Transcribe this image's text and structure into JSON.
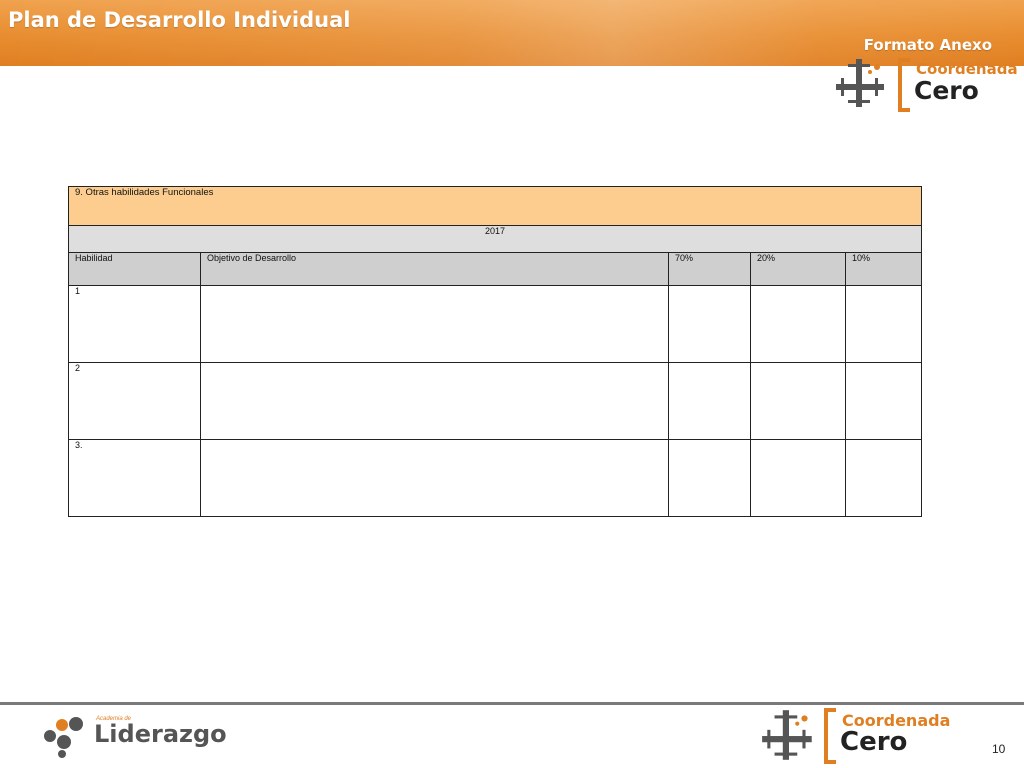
{
  "header": {
    "title": "Plan de Desarrollo Individual",
    "subtitle": "Formato Anexo"
  },
  "logo": {
    "word1": "Coordenada",
    "word2": "Cero"
  },
  "table": {
    "section_title": "9. Otras habilidades Funcionales",
    "year": "2017",
    "columns": [
      "Habilidad",
      "Objetivo de Desarrollo",
      "70%",
      "20%",
      "10%"
    ],
    "rows": [
      {
        "habilidad": "1"
      },
      {
        "habilidad": "2"
      },
      {
        "habilidad": "3."
      }
    ]
  },
  "footer": {
    "academy_small": "Academia de",
    "academy_name": "Liderazgo",
    "page_number": "10"
  },
  "colors": {
    "header_orange": "#e88d30",
    "title_row": "#fccd8f",
    "year_row": "#dedede",
    "column_row": "#cfcfcf"
  }
}
